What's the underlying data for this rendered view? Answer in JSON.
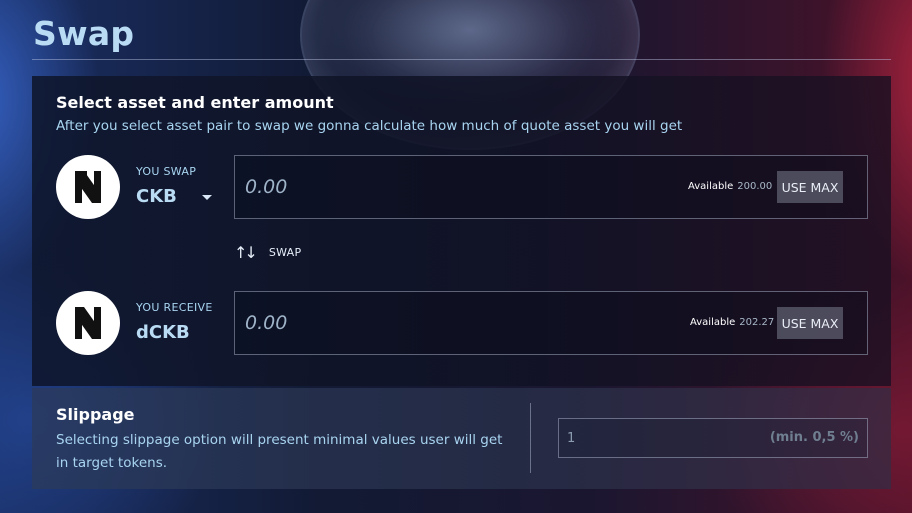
{
  "header": {
    "title": "Swap"
  },
  "panel": {
    "heading": "Select asset and enter amount",
    "subtitle": "After you select asset pair to swap we gonna calculate how much of quote asset you will get"
  },
  "from": {
    "caption": "YOU SWAP",
    "token": "CKB",
    "icon": "nervos-logo-icon",
    "amount_placeholder": "0.00",
    "available_label": "Available",
    "available_value": "200.00",
    "use_max_label": "USE MAX"
  },
  "swap_toggle": {
    "label": "SWAP",
    "icon": "swap-arrows-icon"
  },
  "to": {
    "caption": "YOU RECEIVE",
    "token": "dCKB",
    "icon": "nervos-logo-icon",
    "amount_placeholder": "0.00",
    "available_label": "Available",
    "available_value": "202.27",
    "use_max_label": "USE MAX"
  },
  "slippage": {
    "heading": "Slippage",
    "description": "Selecting slippage option will present minimal values user will get in target tokens.",
    "value": "1",
    "min_hint": "(min. 0,5 %)"
  },
  "colors": {
    "title": "#b9dcf4",
    "subtitle": "#a8d4f0",
    "use_max_bg": "#6c7080"
  }
}
